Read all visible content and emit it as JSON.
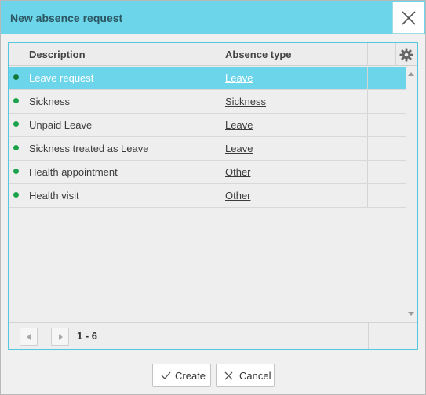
{
  "dialog": {
    "title": "New absence request",
    "close_icon": "close-icon"
  },
  "grid": {
    "columns": {
      "description": "Description",
      "absence_type": "Absence type"
    },
    "settings_icon": "gear-icon",
    "rows": [
      {
        "description": "Leave request",
        "absence_type": "Leave",
        "selected": true
      },
      {
        "description": "Sickness",
        "absence_type": "Sickness",
        "selected": false
      },
      {
        "description": "Unpaid Leave",
        "absence_type": "Leave",
        "selected": false
      },
      {
        "description": "Sickness treated as Leave",
        "absence_type": "Leave",
        "selected": false
      },
      {
        "description": "Health appointment",
        "absence_type": "Other",
        "selected": false
      },
      {
        "description": "Health visit",
        "absence_type": "Other",
        "selected": false
      }
    ],
    "status_color": "#1aa34a",
    "selection_color": "#6dd5ea"
  },
  "pager": {
    "range": "1 - 6"
  },
  "buttons": {
    "create": "Create",
    "cancel": "Cancel"
  }
}
